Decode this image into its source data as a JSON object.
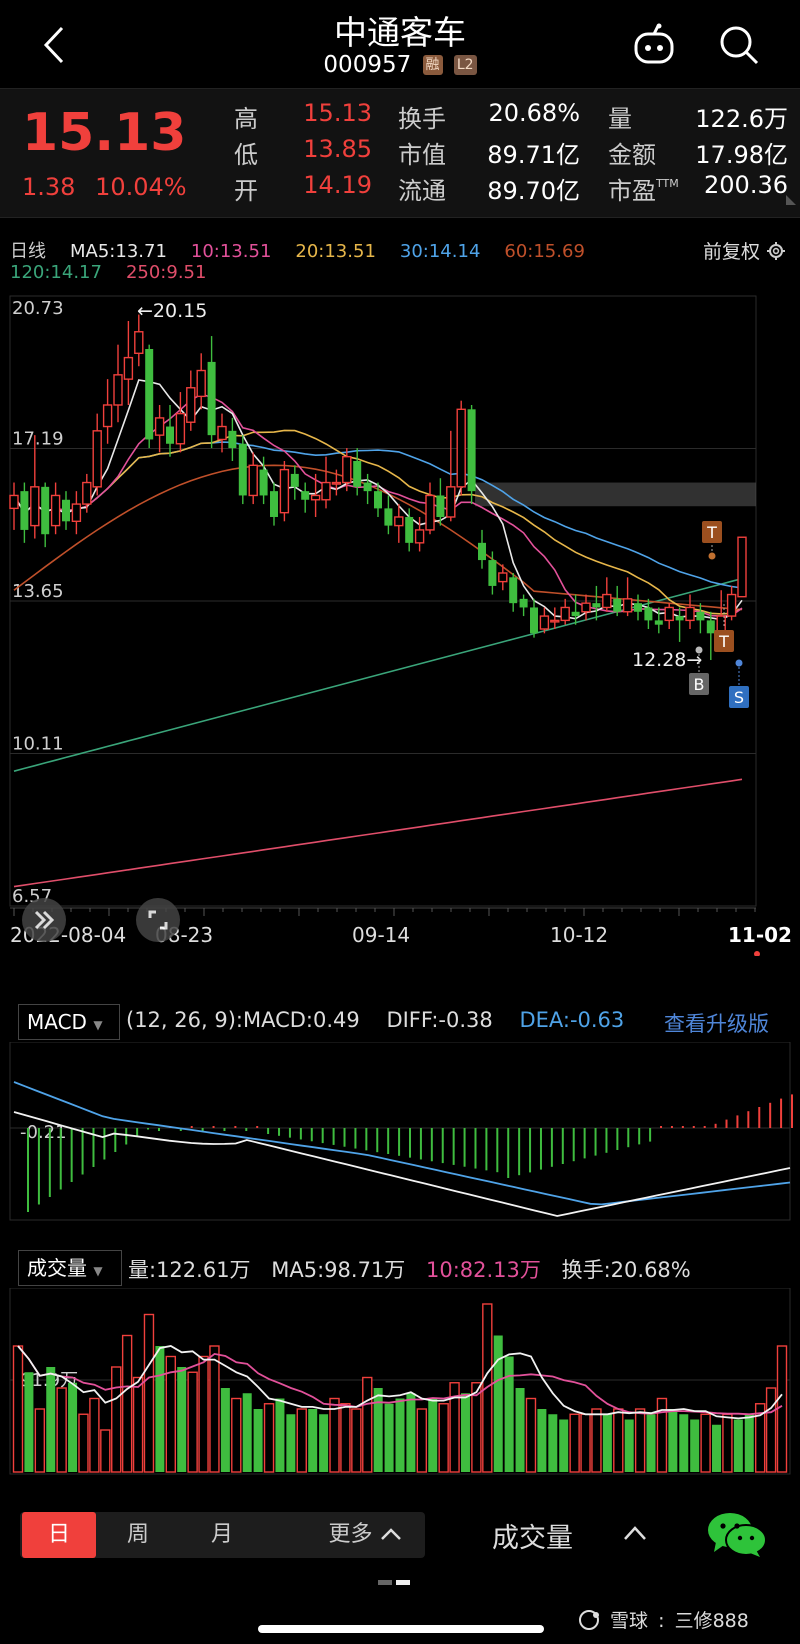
{
  "header": {
    "title": "中通客车",
    "code": "000957",
    "tag_margin": "融",
    "tag_level": "L2"
  },
  "quote": {
    "price": "15.13",
    "change": "1.38",
    "change_pct": "10.04%",
    "rows": [
      [
        {
          "label": "高",
          "value": "15.13",
          "color": "red"
        },
        {
          "label": "换手",
          "value": "20.68%",
          "color": "white"
        },
        {
          "label": "量",
          "value": "122.6万",
          "color": "white"
        }
      ],
      [
        {
          "label": "低",
          "value": "13.85",
          "color": "red"
        },
        {
          "label": "市值",
          "value": "89.71亿",
          "color": "white"
        },
        {
          "label": "金额",
          "value": "17.98亿",
          "color": "white"
        }
      ],
      [
        {
          "label": "开",
          "value": "14.19",
          "color": "red"
        },
        {
          "label": "流通",
          "value": "89.70亿",
          "color": "white"
        },
        {
          "label": "市盈",
          "value": "200.36",
          "color": "white"
        }
      ]
    ],
    "pe_superscript": "TTM"
  },
  "ma_bar": {
    "line1": [
      {
        "text": "日线",
        "color": "#cccccc"
      },
      {
        "text": "MA5:13.71",
        "color": "#e8e8e8"
      },
      {
        "text": "10:13.51",
        "color": "#e2519a"
      },
      {
        "text": "20:13.51",
        "color": "#e6b64a"
      },
      {
        "text": "30:14.14",
        "color": "#4fa3e8"
      },
      {
        "text": "60:15.69",
        "color": "#c0502a"
      }
    ],
    "line2": [
      {
        "text": "120:14.17",
        "color": "#3aa57a"
      },
      {
        "text": "250:9.51",
        "color": "#e04e6a"
      }
    ],
    "adjust_label": "前复权"
  },
  "main_chart": {
    "y_labels": [
      "20.73",
      "17.19",
      "13.65",
      "10.11",
      "6.57"
    ],
    "x_labels": [
      "2022-08-04",
      "08-23",
      "09-14",
      "10-12",
      "11-02"
    ],
    "high_note": "←20.15",
    "low_note": "12.28→",
    "marker_T": "T",
    "marker_B": "B",
    "marker_S": "S"
  },
  "macd": {
    "selector": "MACD",
    "params": "(12, 26, 9):MACD:0.49",
    "diff": "DIFF:-0.38",
    "dea": "DEA:-0.63",
    "upgrade": "查看升级版",
    "y_label": "-0.21"
  },
  "volume": {
    "selector": "成交量",
    "vol": "量:122.61万",
    "ma5": "MA5:98.71万",
    "ma10": "10:82.13万",
    "turnover": "换手:20.68%",
    "y_label": "91.9万"
  },
  "bottom": {
    "periods": [
      "日",
      "周",
      "月"
    ],
    "more": "更多",
    "indicator": "成交量"
  },
  "watermark": {
    "brand": "雪球",
    "user": "三修888"
  },
  "chart_data": {
    "type": "candlestick",
    "candles": [
      [
        15.8,
        16.1,
        15.3,
        16.4
      ],
      [
        16.2,
        15.3,
        15.0,
        16.4
      ],
      [
        15.4,
        16.3,
        15.1,
        17.5
      ],
      [
        16.3,
        15.2,
        14.9,
        16.4
      ],
      [
        15.4,
        16.1,
        15.2,
        16.4
      ],
      [
        16.0,
        15.5,
        15.3,
        16.2
      ],
      [
        15.5,
        15.9,
        15.2,
        16.2
      ],
      [
        15.9,
        16.4,
        15.7,
        16.6
      ],
      [
        16.3,
        17.6,
        16.1,
        18.0
      ],
      [
        17.7,
        18.2,
        17.3,
        18.8
      ],
      [
        18.2,
        18.9,
        17.8,
        19.6
      ],
      [
        18.8,
        19.3,
        18.2,
        20.15
      ],
      [
        19.4,
        19.9,
        19.1,
        20.3
      ],
      [
        19.5,
        17.4,
        17.2,
        19.6
      ],
      [
        17.5,
        17.9,
        17.1,
        18.2
      ],
      [
        17.7,
        17.3,
        17.0,
        18.2
      ],
      [
        17.3,
        18.0,
        17.1,
        18.5
      ],
      [
        17.8,
        18.6,
        17.6,
        19.0
      ],
      [
        18.4,
        19.0,
        18.1,
        19.4
      ],
      [
        19.2,
        17.5,
        17.2,
        19.8
      ],
      [
        17.4,
        17.7,
        17.1,
        18.0
      ],
      [
        17.6,
        17.2,
        16.9,
        17.9
      ],
      [
        17.3,
        16.1,
        15.9,
        17.5
      ],
      [
        16.1,
        16.8,
        15.9,
        17.1
      ],
      [
        16.7,
        16.1,
        15.9,
        17.0
      ],
      [
        16.2,
        15.6,
        15.4,
        16.4
      ],
      [
        15.7,
        16.7,
        15.5,
        16.9
      ],
      [
        16.6,
        16.3,
        16.0,
        16.8
      ],
      [
        16.2,
        16.0,
        15.7,
        16.4
      ],
      [
        16.0,
        16.1,
        15.6,
        16.6
      ],
      [
        16.0,
        16.4,
        15.8,
        17.0
      ],
      [
        16.4,
        16.4,
        16.1,
        16.7
      ],
      [
        16.4,
        17.0,
        16.2,
        17.2
      ],
      [
        16.9,
        16.3,
        16.1,
        17.2
      ],
      [
        16.4,
        16.2,
        15.9,
        16.6
      ],
      [
        16.2,
        15.8,
        15.6,
        16.4
      ],
      [
        15.8,
        15.4,
        15.2,
        16.1
      ],
      [
        15.4,
        15.6,
        15.0,
        15.9
      ],
      [
        15.6,
        15.0,
        14.8,
        15.8
      ],
      [
        15.0,
        15.3,
        14.8,
        15.6
      ],
      [
        15.3,
        16.1,
        15.2,
        16.4
      ],
      [
        16.1,
        15.6,
        15.4,
        16.5
      ],
      [
        15.6,
        16.3,
        15.5,
        17.6
      ],
      [
        16.3,
        18.1,
        16.1,
        18.3
      ],
      [
        18.1,
        16.2,
        15.9,
        18.2
      ],
      [
        15.0,
        14.6,
        14.4,
        15.3
      ],
      [
        14.6,
        14.0,
        13.8,
        14.8
      ],
      [
        14.1,
        14.3,
        13.9,
        14.5
      ],
      [
        14.2,
        13.6,
        13.4,
        14.3
      ],
      [
        13.7,
        13.5,
        13.3,
        13.8
      ],
      [
        13.5,
        12.9,
        12.8,
        13.7
      ],
      [
        13.0,
        13.3,
        12.9,
        13.5
      ],
      [
        13.2,
        13.2,
        13.0,
        13.5
      ],
      [
        13.2,
        13.5,
        13.1,
        13.7
      ],
      [
        13.4,
        13.3,
        13.1,
        13.8
      ],
      [
        13.4,
        13.6,
        13.2,
        13.8
      ],
      [
        13.6,
        13.5,
        13.2,
        14.0
      ],
      [
        13.5,
        13.8,
        13.4,
        14.2
      ],
      [
        13.7,
        13.4,
        13.3,
        14.0
      ],
      [
        13.4,
        13.7,
        13.3,
        14.2
      ],
      [
        13.6,
        13.4,
        13.2,
        13.8
      ],
      [
        13.5,
        13.2,
        13.0,
        13.7
      ],
      [
        13.2,
        13.1,
        12.9,
        13.5
      ],
      [
        13.2,
        13.5,
        13.0,
        13.6
      ],
      [
        13.3,
        13.2,
        12.7,
        13.5
      ],
      [
        13.2,
        13.5,
        13.0,
        13.8
      ],
      [
        13.4,
        13.2,
        12.9,
        13.6
      ],
      [
        13.2,
        12.9,
        12.28,
        13.4
      ],
      [
        12.9,
        13.3,
        12.8,
        13.9
      ],
      [
        13.3,
        13.8,
        13.2,
        14.0
      ],
      [
        13.75,
        15.13,
        13.85,
        15.13
      ]
    ],
    "y_range": [
      6.57,
      20.73
    ],
    "x_labels": [
      "2022-08-04",
      "08-23",
      "09-14",
      "10-12",
      "11-02"
    ],
    "ma": {
      "MA5": 13.71,
      "MA10": 13.51,
      "MA20": 13.51,
      "MA30": 14.14,
      "MA60": 15.69,
      "MA120": 14.17,
      "MA250": 9.51
    },
    "macd": {
      "MACD": 0.49,
      "DIFF": -0.38,
      "DEA": -0.63
    },
    "volume": {
      "last": "122.61万",
      "MA5": "98.71万",
      "MA10": "82.13万"
    }
  }
}
